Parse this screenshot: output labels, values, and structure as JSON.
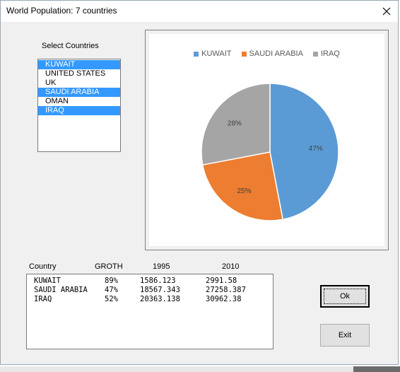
{
  "window": {
    "title": "World Population: 7 countries"
  },
  "select_label": "Select Countries",
  "countries": [
    {
      "name": "KUWAIT",
      "selected": true
    },
    {
      "name": "UNITED STATES",
      "selected": false
    },
    {
      "name": "UK",
      "selected": false
    },
    {
      "name": "SAUDI ARABIA",
      "selected": true
    },
    {
      "name": "OMAN",
      "selected": false
    },
    {
      "name": "IRAQ",
      "selected": true
    }
  ],
  "chart_data": {
    "type": "pie",
    "categories": [
      "KUWAIT",
      "SAUDI ARABIA",
      "IRAQ"
    ],
    "values": [
      47,
      25,
      28
    ],
    "labels": [
      "47%",
      "25%",
      "28%"
    ],
    "colors": [
      "#5b9bd5",
      "#ed7d31",
      "#a5a5a5"
    ],
    "legend": "top"
  },
  "table": {
    "headers": [
      "Country",
      "GROTH",
      "1995",
      "2010"
    ],
    "rows": [
      [
        "KUWAIT",
        "89%",
        "1586.123",
        "2991.58"
      ],
      [
        "SAUDI ARABIA",
        "47%",
        "18567.343",
        "27258.387"
      ],
      [
        "IRAQ",
        "52%",
        "20363.138",
        "30962.38"
      ]
    ]
  },
  "buttons": {
    "ok": "Ok",
    "exit": "Exit"
  }
}
